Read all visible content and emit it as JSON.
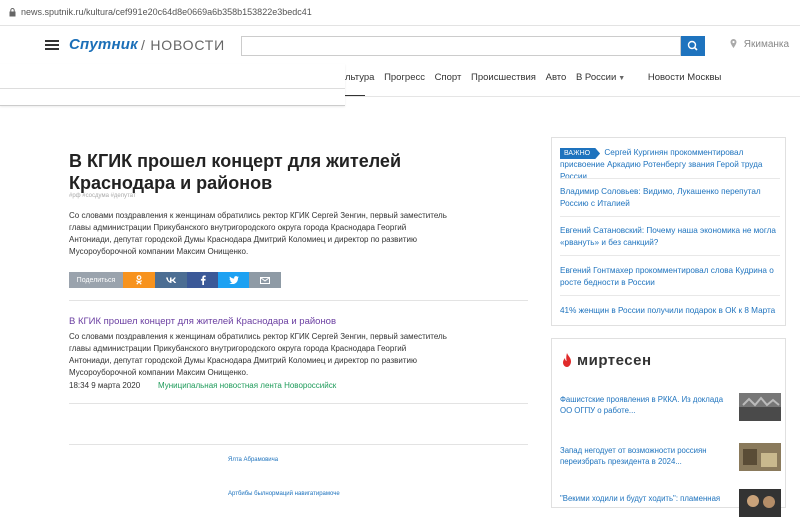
{
  "browser": {
    "url": "news.sputnik.ru/kultura/cef991e20c64d8e0669a6b358b153822e3bedc41"
  },
  "header": {
    "logo": "Спутник",
    "section": "/ НОВОСТИ",
    "search_placeholder": "",
    "location": "Якиманка"
  },
  "nav": {
    "items": [
      "льтура",
      "Прогресс",
      "Спорт",
      "Происшествия",
      "Авто",
      "В России",
      "Новости Москвы"
    ]
  },
  "article": {
    "title": "В КГИК прошел концерт для жителей Краснодара и районов",
    "tags": "#рф  #сосдума  #депутат",
    "lead": "Со словами поздравления к женщинам обратились ректор КГИК Сергей Зенгин, первый заместитель главы администрации Прикубанского внутригородского округа города Краснодара Георгий Антониади, депутат городской Думы Краснодара Дмитрий Коломиец и директор по развитию Мусороуборочной компании Максим Онищенко.",
    "share_label": "Поделиться"
  },
  "related": {
    "title": "В КГИК прошел концерт для жителей Краснодара и районов",
    "text": "Со словами поздравления к женщинам обратились ректор КГИК Сергей Зенгин, первый заместитель главы администрации Прикубанского внутригородского округа города Краснодара Георгий Антониади, депутат городской Думы Краснодара Дмитрий Коломиец и директор по развитию Мусороуборочной компании Максим Онищенко.",
    "date": "18:34 9 марта 2020",
    "source": "Муниципальная новостная лента Новороссийск"
  },
  "more": {
    "author": "Ялта Абрамовича",
    "cut_link": "Артбибы былнормаций навигатирамоче"
  },
  "sidebar": {
    "badge": "ВАЖНО",
    "news": [
      "Сергей Кургинян прокомментировал присвоение Аркадию Ротенбергу звания Герой труда России",
      "Владимир Соловьев: Видимо, Лукашенко перепутал Россию с Италией",
      "Евгений Сатановский: Почему наша экономика не могла «рвануть» и без санкций?",
      "Евгений Гонтмахер прокомментировал слова Кудрина о росте бедности в России",
      "41% женщин в России получили подарок в ОК к 8 Марта"
    ]
  },
  "mirtesen": {
    "logo": "миртесен",
    "items": [
      "Фашистские проявления в РККА. Из доклада ОО ОГПУ о работе...",
      "Запад негодует от возможности россиян переизбрать президента в 2024...",
      "\"Векими ходили и будут ходить\": пламенная"
    ]
  },
  "colors": {
    "brand": "#1e73be",
    "important": "#1e73be",
    "related_title": "#6a3ea1",
    "source": "#1e9b5a"
  },
  "icons": [
    "lock-icon",
    "menu-icon",
    "search-icon",
    "location-pin-icon",
    "ok-icon",
    "vk-icon",
    "facebook-icon",
    "twitter-icon",
    "mail-icon",
    "fire-icon"
  ]
}
